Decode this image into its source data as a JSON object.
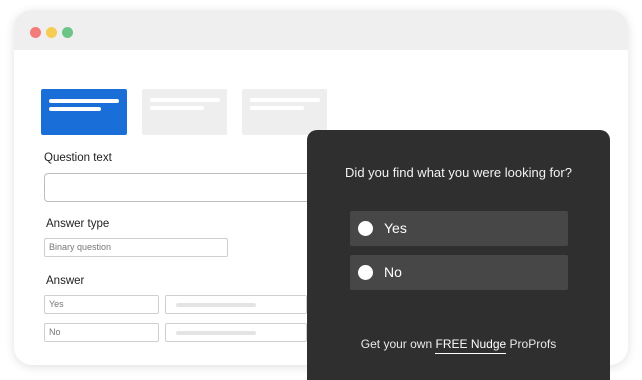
{
  "window": {
    "traffic_lights": {
      "close": "#f47b7b",
      "minimize": "#f6cd52",
      "maximize": "#6bc587"
    }
  },
  "tabs": [
    {
      "state": "active",
      "color": "#1a6ed8"
    },
    {
      "state": "inactive",
      "color": "#eeeeee"
    },
    {
      "state": "inactive",
      "color": "#eeeeee"
    }
  ],
  "form": {
    "question_label": "Question text",
    "question_value": "",
    "answer_type_label": "Answer type",
    "answer_type_value": "Binary question",
    "answer_label": "Answer",
    "answers": [
      "Yes",
      "No"
    ]
  },
  "nudge": {
    "question": "Did you find what you were looking for?",
    "options": [
      "Yes",
      "No"
    ],
    "footer_prefix": "Get your own",
    "footer_link": "FREE Nudge",
    "footer_brand": "ProProfs"
  }
}
